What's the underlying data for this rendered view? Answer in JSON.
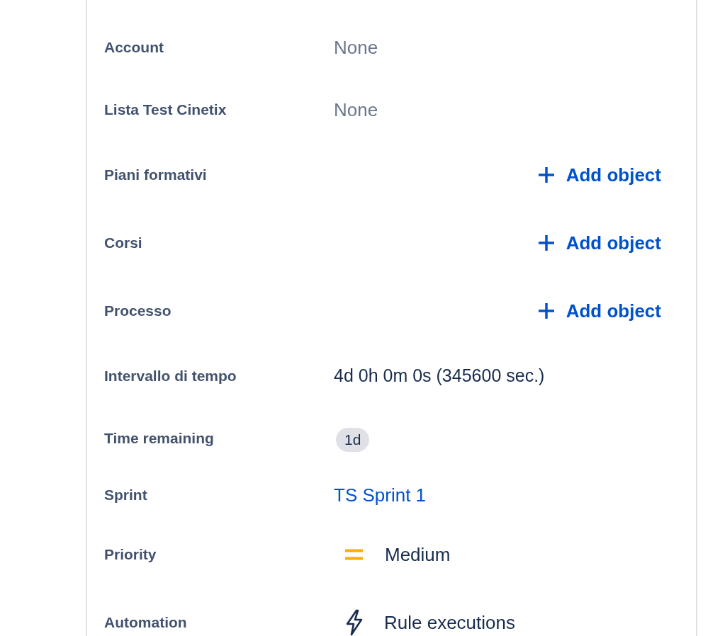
{
  "fields": [
    {
      "label": "Account",
      "kind": "text",
      "value": "None"
    },
    {
      "label": "Lista Test Cinetix",
      "kind": "text",
      "value": "None"
    },
    {
      "label": "Piani formativi",
      "kind": "add",
      "value": "Add object"
    },
    {
      "label": "Corsi",
      "kind": "add",
      "value": "Add object"
    },
    {
      "label": "Processo",
      "kind": "add",
      "value": "Add object"
    },
    {
      "label": "Intervallo di tempo",
      "kind": "plain",
      "value": "4d 0h 0m 0s (345600 sec.)"
    },
    {
      "label": "Time remaining",
      "kind": "badge",
      "value": "1d"
    },
    {
      "label": "Sprint",
      "kind": "link",
      "value": "TS Sprint 1"
    },
    {
      "label": "Priority",
      "kind": "priority",
      "value": "Medium"
    },
    {
      "label": "Automation",
      "kind": "automation",
      "value": "Rule executions"
    }
  ]
}
